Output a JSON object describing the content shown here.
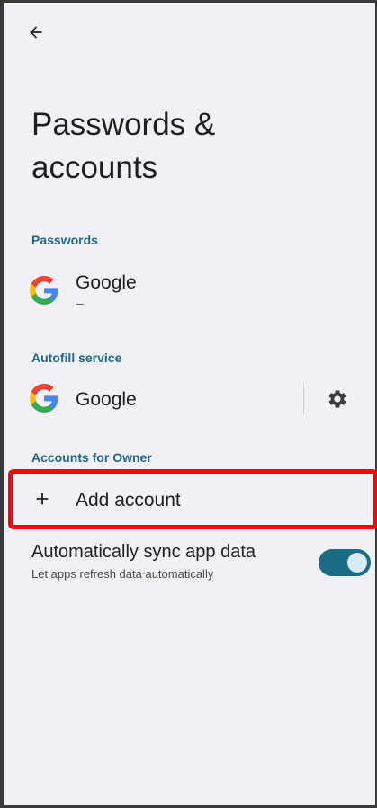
{
  "header": {
    "back_icon": "arrow-back-icon",
    "title": "Passwords & accounts"
  },
  "passwords": {
    "section_label": "Passwords",
    "item": {
      "icon": "google-icon",
      "label": "Google",
      "subtitle": "–"
    }
  },
  "autofill": {
    "section_label": "Autofill service",
    "item": {
      "icon": "google-icon",
      "label": "Google"
    },
    "settings_icon": "gear-icon"
  },
  "accounts": {
    "section_label": "Accounts for Owner",
    "add": {
      "icon": "plus-icon",
      "label": "Add account"
    }
  },
  "sync": {
    "label": "Automatically sync app data",
    "subtitle": "Let apps refresh data automatically",
    "enabled": true
  },
  "colors": {
    "accent": "#1f6a8a",
    "toggle_on": "#1b6a86",
    "highlight": "#ff0000",
    "background": "#f1f0f5"
  }
}
